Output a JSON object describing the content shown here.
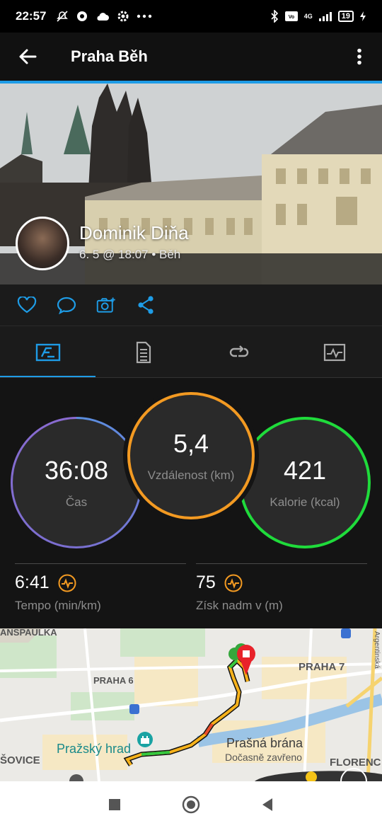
{
  "status_bar": {
    "time": "22:57",
    "left_icons": [
      "do-not-disturb-icon",
      "sync-icon",
      "cloud-icon",
      "settings-icon",
      "more-dots-icon"
    ],
    "right_icons": [
      "bluetooth-icon",
      "volte-icon",
      "signal-icon"
    ],
    "network": "4G",
    "battery": "19"
  },
  "app_bar": {
    "title": "Praha Běh"
  },
  "activity": {
    "owner_name": "Dominik Diňa",
    "meta": "6. 5 @ 18:07 • Běh"
  },
  "actions": [
    "like-icon",
    "comment-icon",
    "add-photo-icon",
    "share-icon"
  ],
  "tabs": [
    {
      "name": "overview",
      "active": true
    },
    {
      "name": "details",
      "active": false
    },
    {
      "name": "laps",
      "active": false
    },
    {
      "name": "charts",
      "active": false
    }
  ],
  "stats": {
    "time": {
      "value": "36:08",
      "label": "Čas"
    },
    "distance": {
      "value": "5,4",
      "label": "Vzdálenost (km)"
    },
    "calories": {
      "value": "421",
      "label": "Kalorie (kcal)"
    },
    "pace": {
      "value": "6:41",
      "label": "Tempo (min/km)"
    },
    "elevation": {
      "value": "75",
      "label": "Získ nadm v (m)"
    }
  },
  "colors": {
    "accent": "#1e9ce6",
    "distance_ring": "#f39a22",
    "calories_ring": "#1fdb3b",
    "time_ring": "#6d7fd8"
  },
  "map": {
    "labels": {
      "l1": "ANSPAULKA",
      "l2": "PRAHA 6",
      "l3": "PRAHA 7",
      "l4": "Pražský hrad",
      "l5": "Prašná brána",
      "l6": "Dočasně zavřeno",
      "l7": "ŠOVICE",
      "l8": "FLORENC",
      "l9": "Argentinská"
    }
  }
}
